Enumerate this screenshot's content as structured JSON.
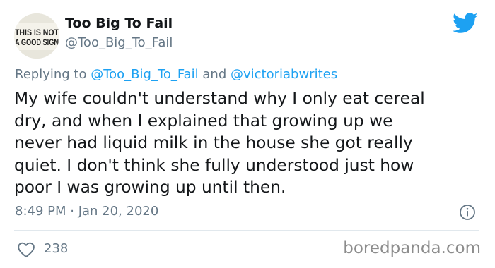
{
  "user": {
    "display_name": "Too Big To Fail",
    "handle": "@Too_Big_To_Fail",
    "avatar": {
      "icon": "sign-avatar-icon",
      "text_line1": "THIS IS NOT",
      "text_line2": "A GOOD SIGN"
    }
  },
  "reply": {
    "prefix": "Replying to",
    "mention1": "@Too_Big_To_Fail",
    "and": "and",
    "mention2": "@victoriabwrites"
  },
  "tweet": {
    "lines": [
      "My wife couldn't understand why I only eat cereal",
      "dry, and when I explained that growing up we",
      "never had liquid milk in the house she got really",
      "quiet. I don't think she fully understood just how",
      "poor I was growing up until then."
    ]
  },
  "meta": {
    "timestamp": "8:49 PM · Jan 20, 2020"
  },
  "actions": {
    "like_count": "238"
  },
  "watermark": "boredpanda.com",
  "colors": {
    "text": "#14171a",
    "muted": "#657786",
    "twitter_blue": "#1da1f2",
    "divider": "#e1e8ed"
  },
  "icons": {
    "brand": "twitter-bird-icon",
    "info": "info-icon",
    "like": "heart-icon"
  }
}
